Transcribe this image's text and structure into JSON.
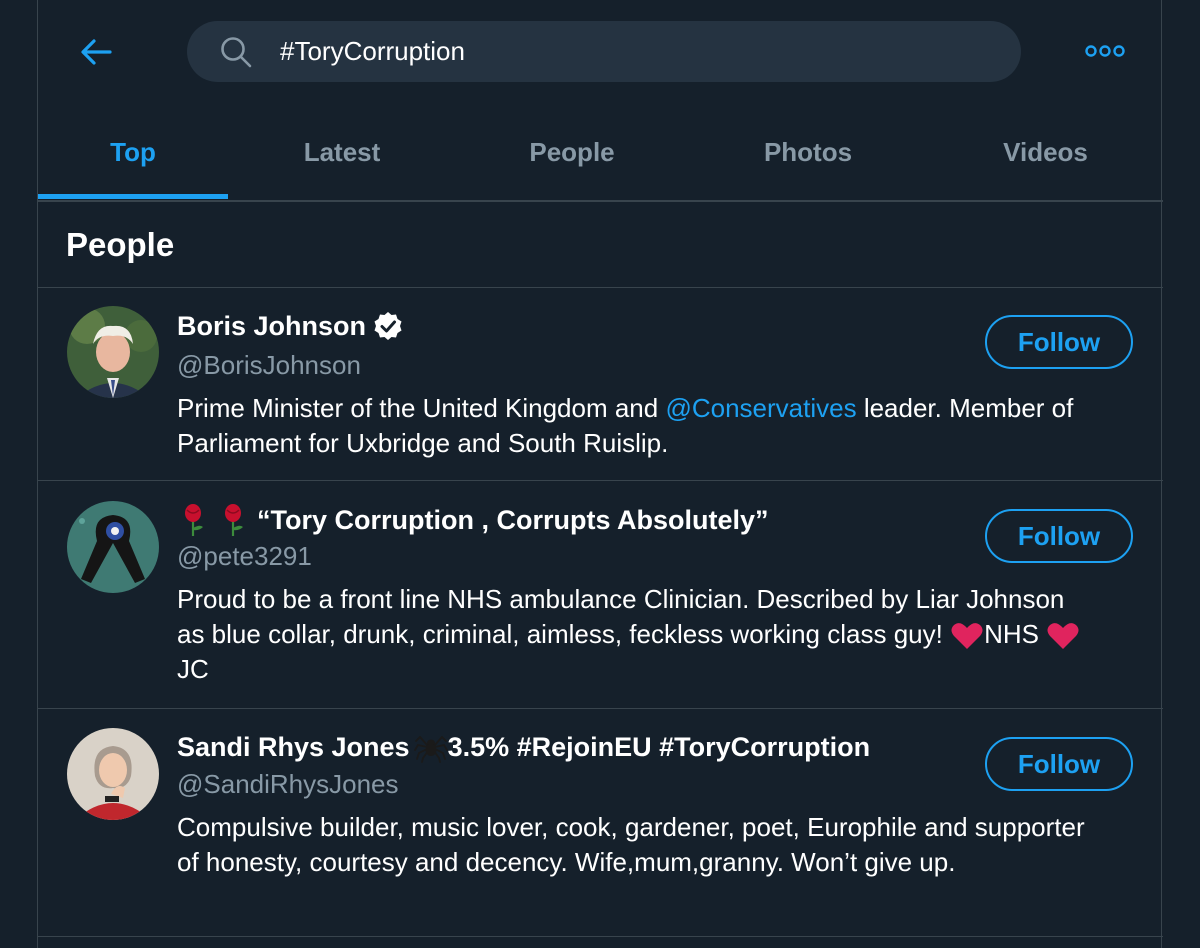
{
  "search": {
    "query": "#ToryCorruption"
  },
  "tabs": [
    {
      "label": "Top",
      "active": true
    },
    {
      "label": "Latest",
      "active": false
    },
    {
      "label": "People",
      "active": false
    },
    {
      "label": "Photos",
      "active": false
    },
    {
      "label": "Videos",
      "active": false
    }
  ],
  "section": {
    "title": "People"
  },
  "users": [
    {
      "name": "Boris Johnson",
      "verified": true,
      "handle": "@BorisJohnson",
      "bio_before": "Prime Minister of the United Kingdom and ",
      "bio_mention": "@Conservatives",
      "bio_after": " leader. Member of Parliament for Uxbridge and South Ruislip.",
      "follow_label": "Follow"
    },
    {
      "name_prefix_icons": [
        "rose-icon",
        "rose-icon"
      ],
      "name": "“Tory Corruption , Corrupts Absolutely”",
      "handle": "@pete3291",
      "bio_before": "Proud to be a front line NHS ambulance Clinician. Described by Liar Johnson as blue collar, drunk, criminal, aimless, feckless working class guy! ",
      "bio_heart1_text": "NHS ",
      "bio_heart2_text": "JC",
      "follow_label": "Follow"
    },
    {
      "name_part1": "Sandi Rhys Jones",
      "name_icon": "spider-icon",
      "name_part2": " 3.5% #RejoinEU #ToryCorruption",
      "handle": "@SandiRhysJones",
      "bio": "Compulsive builder, music lover, cook, gardener, poet, Europhile and supporter of honesty, courtesy and decency. Wife,mum,granny. Won’t give up.",
      "follow_label": "Follow"
    }
  ],
  "colors": {
    "background": "#15202b",
    "accent": "#1da1f2",
    "muted": "#8899a6",
    "divider": "#38444d",
    "search_bg": "#253341",
    "heart": "#e0245e"
  }
}
